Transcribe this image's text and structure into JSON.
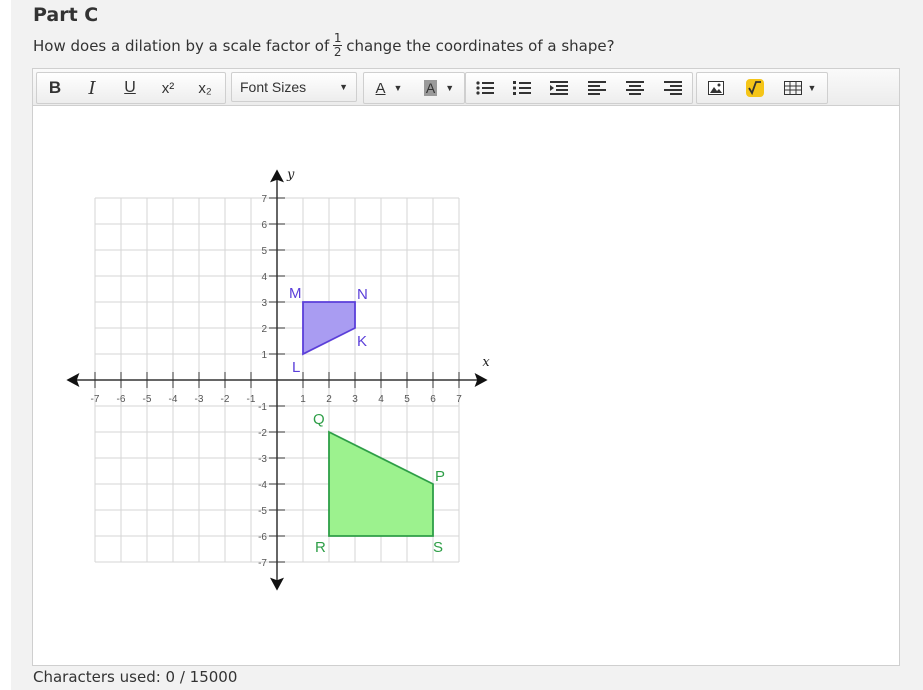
{
  "part_title": "Part C",
  "question": {
    "before": "How does a dilation by a scale factor of",
    "fraction_numerator": "1",
    "fraction_denominator": "2",
    "after": "change the coordinates of a shape?"
  },
  "toolbar": {
    "bold": "B",
    "italic": "I",
    "underline": "U",
    "superscript": "x²",
    "subscript": "x₂",
    "font_sizes": "Font Sizes",
    "font_color": "A",
    "highlight_color": "A",
    "icons": [
      "bullet-list-icon",
      "numbered-list-icon",
      "indent-icon",
      "align-left-icon",
      "align-center-icon",
      "align-right-icon",
      "image-icon",
      "equation-icon",
      "table-icon"
    ]
  },
  "graph": {
    "x_label": "x",
    "y_label": "y",
    "x_ticks": [
      "-7",
      "-6",
      "-5",
      "-4",
      "-3",
      "-2",
      "-1",
      "1",
      "2",
      "3",
      "4",
      "5",
      "6",
      "7"
    ],
    "y_ticks_pos": [
      "7",
      "6",
      "5",
      "4",
      "3",
      "2",
      "1"
    ],
    "y_ticks_neg": [
      "-1",
      "-2",
      "-3",
      "-4",
      "-5",
      "-6",
      "-7"
    ],
    "shape_purple": {
      "color": "#a99cf2",
      "stroke": "#5b3fd9",
      "points": [
        {
          "label": "L",
          "x": 1,
          "y": 1
        },
        {
          "label": "M",
          "x": 1,
          "y": 3
        },
        {
          "label": "N",
          "x": 3,
          "y": 3
        },
        {
          "label": "K",
          "x": 3,
          "y": 2
        }
      ]
    },
    "shape_green": {
      "color": "#9cf28e",
      "stroke": "#2e9e47",
      "points": [
        {
          "label": "Q",
          "x": 2,
          "y": -2
        },
        {
          "label": "P",
          "x": 6,
          "y": -4
        },
        {
          "label": "S",
          "x": 6,
          "y": -6
        },
        {
          "label": "R",
          "x": 2,
          "y": -6
        }
      ]
    }
  },
  "characters_used": "Characters used: 0 / 15000"
}
